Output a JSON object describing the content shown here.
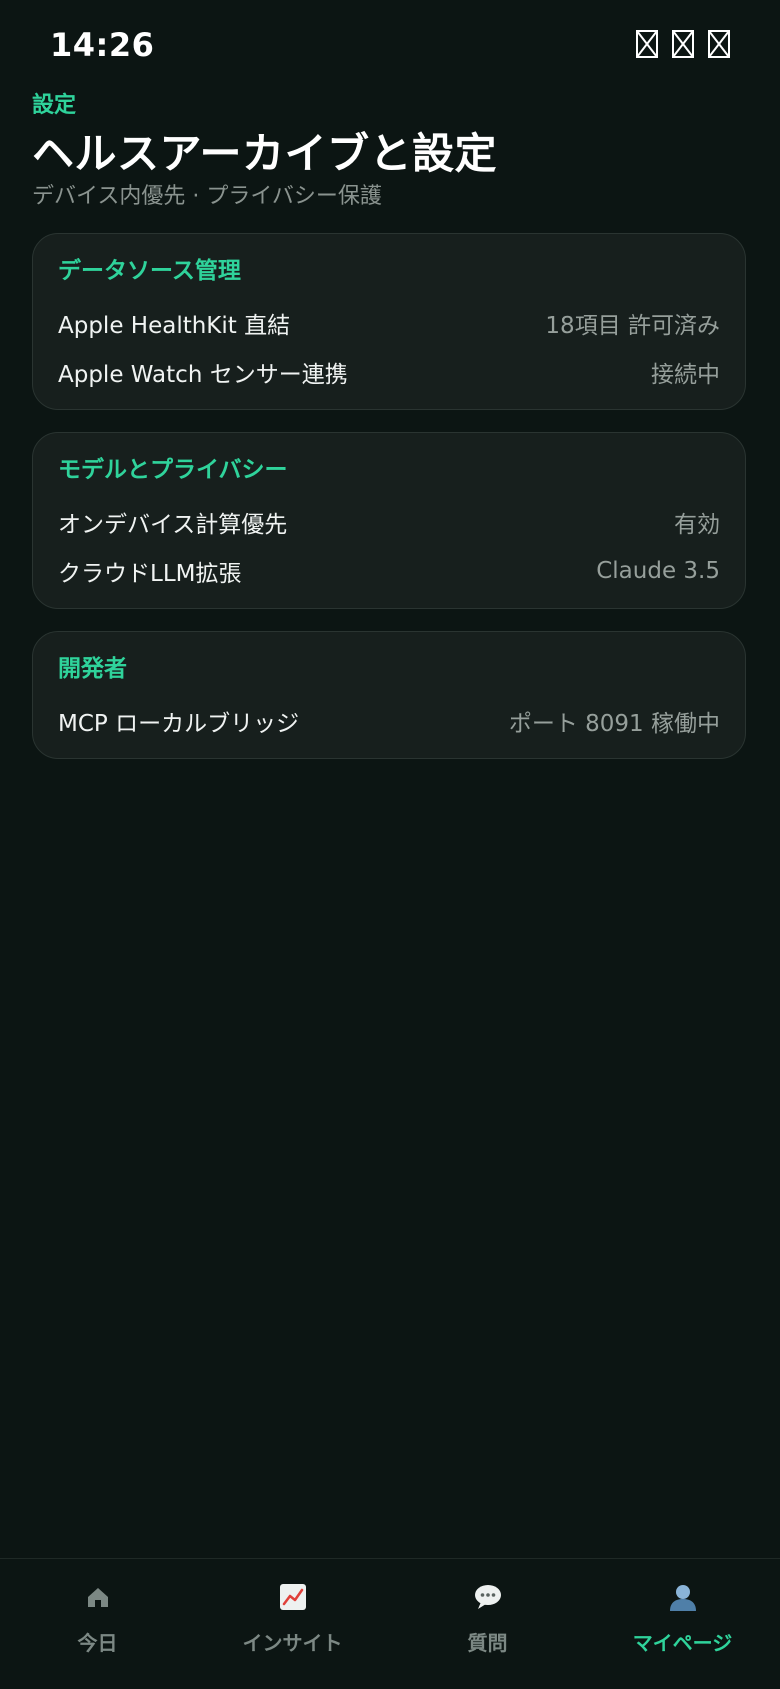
{
  "status_bar": {
    "time": "14:26"
  },
  "header": {
    "eyebrow": "設定",
    "title": "ヘルスアーカイブと設定",
    "subtitle": "デバイス内優先 · プライバシー保護"
  },
  "sections": [
    {
      "title": "データソース管理",
      "rows": [
        {
          "label": "Apple HealthKit 直結",
          "value": "18項目 許可済み"
        },
        {
          "label": "Apple Watch センサー連携",
          "value": "接続中"
        }
      ]
    },
    {
      "title": "モデルとプライバシー",
      "rows": [
        {
          "label": "オンデバイス計算優先",
          "value": "有効"
        },
        {
          "label": "クラウドLLM拡張",
          "value": "Claude 3.5"
        }
      ]
    },
    {
      "title": "開発者",
      "rows": [
        {
          "label": "MCP ローカルブリッジ",
          "value": "ポート 8091 稼働中"
        }
      ]
    }
  ],
  "tab_bar": {
    "tabs": [
      {
        "label": "今日",
        "icon": "home-icon"
      },
      {
        "label": "インサイト",
        "icon": "chart-icon"
      },
      {
        "label": "質問",
        "icon": "chat-bubble-icon"
      },
      {
        "label": "マイページ",
        "icon": "person-icon"
      }
    ],
    "active_index": 3
  },
  "colors": {
    "background": "#0c1513",
    "card": "#171f1d",
    "accent": "#2fd39b",
    "muted_text": "#969f9b"
  }
}
